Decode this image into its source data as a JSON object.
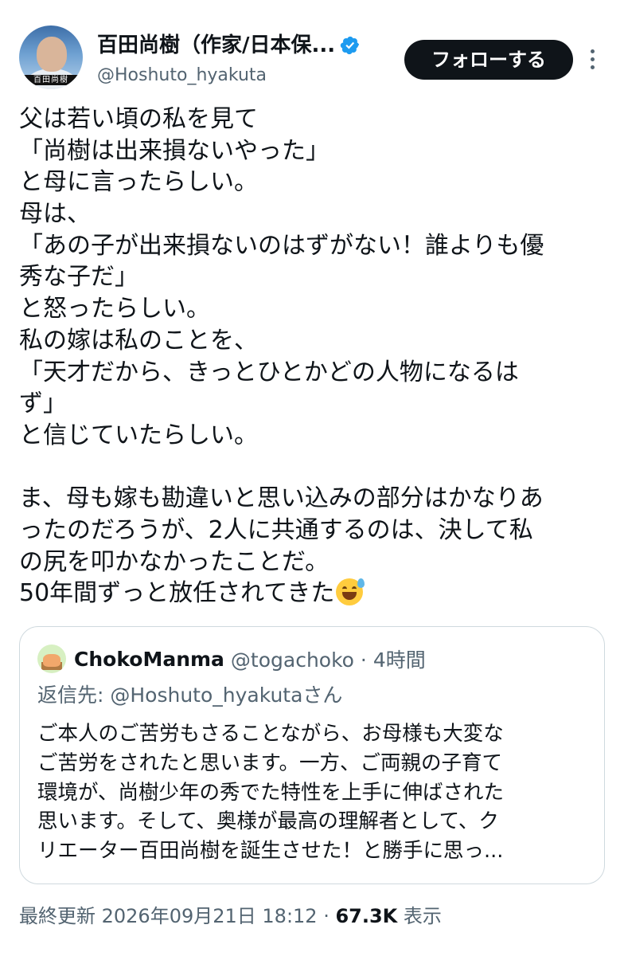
{
  "author": {
    "display_name": "百田尚樹（作家/日本保...",
    "handle": "@Hoshuto_hyakuta",
    "avatar_banner": "百田尚樹"
  },
  "follow_button": "フォローする",
  "tweet_lines": [
    "父は若い頃の私を見て",
    "「尚樹は出来損ないやった」",
    "と母に言ったらしい。",
    "母は、",
    "「あの子が出来損ないのはずがない！誰よりも優",
    "秀な子だ」",
    "と怒ったらしい。",
    "私の嫁は私のことを、",
    "「天才だから、きっとひとかどの人物になるは",
    "ず」",
    "と信じていたらしい。",
    "",
    "ま、母も嫁も勘違いと思い込みの部分はかなりあ",
    "ったのだろうが、2人に共通するのは、決して私",
    "の尻を叩かなかったことだ。",
    "50年間ずっと放任されてきた"
  ],
  "quote": {
    "name": "ChokoManma",
    "handle_time": "@togachoko · 4時間",
    "reply_to": "返信先: @Hoshuto_hyakutaさん",
    "body_lines": [
      "ご本人のご苦労もさることながら、お母様も大変な",
      "ご苦労をされたと思います。一方、ご両親の子育て",
      "環境が、尚樹少年の秀でた特性を上手に伸ばされた",
      "思います。そして、奥様が最高の理解者として、ク",
      "リエーター百田尚樹を誕生させた！と勝手に思っ..."
    ]
  },
  "meta": {
    "updated": "最終更新 2026年09月21日 18:12 · ",
    "views_count": "67.3K",
    "views_label": " 表示"
  },
  "icons": {
    "verified": "verified-badge-icon",
    "more": "more-options-icon",
    "emoji": "sweat-smile-emoji"
  },
  "colors": {
    "text": "#0f1419",
    "secondary": "#536471",
    "verified": "#1d9bf0",
    "follow_bg": "#0f1419",
    "border": "#cfd9de"
  }
}
